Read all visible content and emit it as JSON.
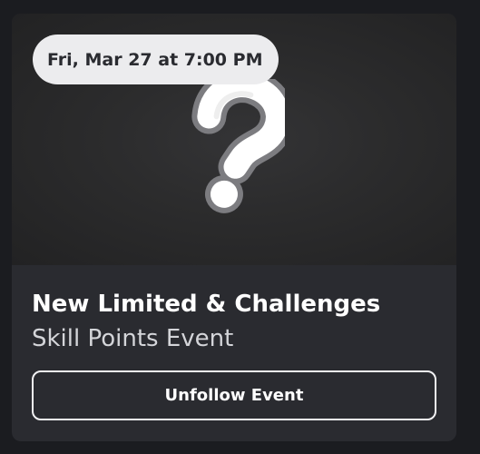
{
  "event": {
    "date_badge": "Fri, Mar 27 at 7:00 PM",
    "title": "New Limited & Challenges",
    "subtitle": "Skill Points Event",
    "thumbnail_icon": "question-mark-icon"
  },
  "actions": {
    "unfollow_label": "Unfollow Event"
  },
  "colors": {
    "background": "#1b1c20",
    "card": "#2a2b30",
    "badge": "#ececee",
    "text_primary": "#ffffff",
    "text_secondary": "#d4d5d9"
  }
}
